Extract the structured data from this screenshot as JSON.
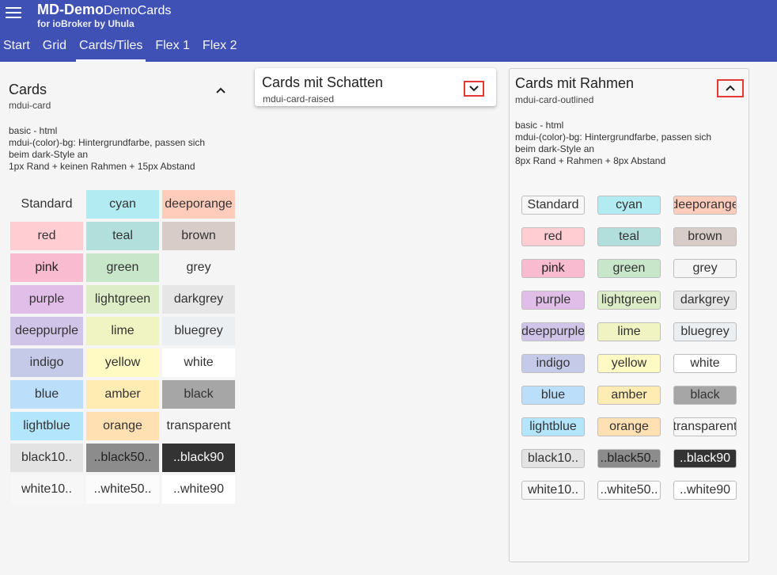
{
  "app": {
    "title_main": "MD-Demo",
    "title_sub": "DemoCards",
    "subtitle": "for ioBroker by Uhula"
  },
  "tabs": [
    {
      "label": "Start"
    },
    {
      "label": "Grid"
    },
    {
      "label": "Cards/Tiles"
    },
    {
      "label": "Flex 1"
    },
    {
      "label": "Flex 2"
    }
  ],
  "active_tab": "Cards/Tiles",
  "cards": {
    "basic": {
      "title": "Cards",
      "class": "mdui-card",
      "desc": [
        "basic - html",
        "mdui-(color)-bg: Hintergrundfarbe, passen sich",
        "beim dark-Style an",
        "1px Rand + keinen Rahmen + 15px Abstand"
      ],
      "toggle_icon": "chevron-up-icon"
    },
    "raised": {
      "title": "Cards mit Schatten",
      "class": "mdui-card-raised",
      "toggle_icon": "chevron-down-icon"
    },
    "outlined": {
      "title": "Cards mit Rahmen",
      "class": "mdui-card-outlined",
      "desc": [
        "basic - html",
        "mdui-(color)-bg: Hintergrundfarbe, passen sich",
        "beim dark-Style an",
        "8px Rand + Rahmen + 8px Abstand"
      ],
      "toggle_icon": "chevron-up-icon"
    }
  },
  "colors": {
    "appbar": "#3f51b5",
    "highlight_frame": "#e53935"
  },
  "tiles": [
    {
      "label": "Standard",
      "bg": "transparent",
      "fg": "#333333"
    },
    {
      "label": "cyan",
      "bg": "#b2ebf2",
      "fg": "#333333"
    },
    {
      "label": "deeporange",
      "bg": "#ffccbc",
      "fg": "#333333"
    },
    {
      "label": "red",
      "bg": "#ffcdd2",
      "fg": "#333333"
    },
    {
      "label": "teal",
      "bg": "#b2dfdb",
      "fg": "#333333"
    },
    {
      "label": "brown",
      "bg": "#d7ccc8",
      "fg": "#333333"
    },
    {
      "label": "pink",
      "bg": "#f8bbd0",
      "fg": "#222222"
    },
    {
      "label": "green",
      "bg": "#c8e6c9",
      "fg": "#333333"
    },
    {
      "label": "grey",
      "bg": "#f5f5f5",
      "fg": "#333333"
    },
    {
      "label": "purple",
      "bg": "#e1bee7",
      "fg": "#333333"
    },
    {
      "label": "lightgreen",
      "bg": "#dcedc8",
      "fg": "#333333"
    },
    {
      "label": "darkgrey",
      "bg": "#e6e6e6",
      "fg": "#333333"
    },
    {
      "label": "deeppurple",
      "bg": "#d1c4e9",
      "fg": "#333333"
    },
    {
      "label": "lime",
      "bg": "#f0f4c3",
      "fg": "#333333"
    },
    {
      "label": "bluegrey",
      "bg": "#eceff1",
      "fg": "#333333"
    },
    {
      "label": "indigo",
      "bg": "#c5cae9",
      "fg": "#333333"
    },
    {
      "label": "yellow",
      "bg": "#fff9c4",
      "fg": "#333333"
    },
    {
      "label": "white",
      "bg": "#ffffff",
      "fg": "#333333"
    },
    {
      "label": "blue",
      "bg": "#bbdefb",
      "fg": "#333333"
    },
    {
      "label": "amber",
      "bg": "#ffecb3",
      "fg": "#333333"
    },
    {
      "label": "black",
      "bg": "#a6a6a6",
      "fg": "#333333"
    },
    {
      "label": "lightblue",
      "bg": "#b3e5fc",
      "fg": "#333333"
    },
    {
      "label": "orange",
      "bg": "#ffe0b2",
      "fg": "#333333"
    },
    {
      "label": "transparent",
      "bg": "transparent",
      "fg": "#333333"
    },
    {
      "label": "black10..",
      "bg": "#e3e3e3",
      "fg": "#333333"
    },
    {
      "label": "..black50..",
      "bg": "#8c8c8c",
      "fg": "#222222"
    },
    {
      "label": "..black90",
      "bg": "#333333",
      "fg": "#ffffff"
    },
    {
      "label": "white10..",
      "bg": "#f7f7f7",
      "fg": "#333333"
    },
    {
      "label": "..white50..",
      "bg": "#fbfbfb",
      "fg": "#333333"
    },
    {
      "label": "..white90",
      "bg": "#ffffff",
      "fg": "#333333"
    }
  ]
}
